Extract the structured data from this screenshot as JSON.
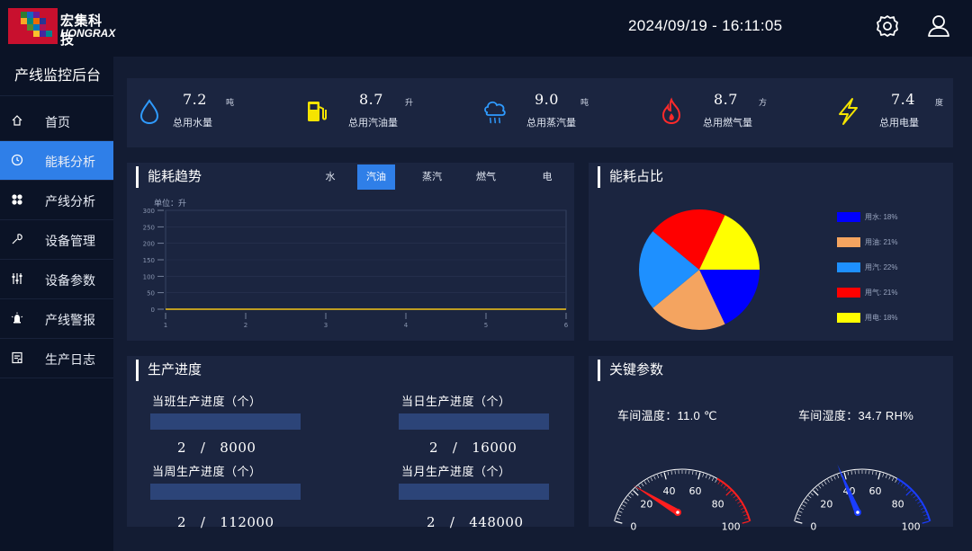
{
  "header": {
    "company_cn": "宏集科技",
    "company_en": "HONGRAX",
    "datetime": "2024/09/19 - 16:11:05",
    "settings_icon": "gear-icon",
    "user_icon": "user-icon"
  },
  "sidebar": {
    "title": "产线监控后台",
    "items": [
      {
        "label": "首页",
        "icon": "home-icon",
        "active": false
      },
      {
        "label": "能耗分析",
        "icon": "clock-icon",
        "active": true
      },
      {
        "label": "产线分析",
        "icon": "grid-icon",
        "active": false
      },
      {
        "label": "设备管理",
        "icon": "wrench-icon",
        "active": false
      },
      {
        "label": "设备参数",
        "icon": "sliders-icon",
        "active": false
      },
      {
        "label": "产线警报",
        "icon": "alarm-icon",
        "active": false
      },
      {
        "label": "生产日志",
        "icon": "log-icon",
        "active": false
      }
    ]
  },
  "kpis": [
    {
      "value": "7.2",
      "unit": "吨",
      "name": "总用水量",
      "icon": "water-drop-icon",
      "color": "#2f9bff"
    },
    {
      "value": "8.7",
      "unit": "升",
      "name": "总用汽油量",
      "icon": "fuel-pump-icon",
      "color": "#f5e400"
    },
    {
      "value": "9.0",
      "unit": "吨",
      "name": "总用蒸汽量",
      "icon": "steam-cloud-icon",
      "color": "#2f9bff"
    },
    {
      "value": "8.7",
      "unit": "方",
      "name": "总用燃气量",
      "icon": "flame-icon",
      "color": "#ff2a2a"
    },
    {
      "value": "7.4",
      "unit": "度",
      "name": "总用电量",
      "icon": "lightning-icon",
      "color": "#f5e400"
    }
  ],
  "trend": {
    "title": "能耗趋势",
    "tabs": [
      "水",
      "汽油",
      "蒸汽",
      "燃气",
      "电"
    ],
    "active_tab": 1
  },
  "ratio": {
    "title": "能耗占比"
  },
  "progress": {
    "title": "生产进度",
    "items": [
      {
        "label": "当班生产进度（个）",
        "current": "2",
        "sep": "/",
        "total": "8000",
        "fraction": 0.00025
      },
      {
        "label": "当日生产进度（个）",
        "current": "2",
        "sep": "/",
        "total": "16000",
        "fraction": 0.000125
      },
      {
        "label": "当周生产进度（个）",
        "current": "2",
        "sep": "/",
        "total": "112000",
        "fraction": 1.79e-05
      },
      {
        "label": "当月生产进度（个）",
        "current": "2",
        "sep": "/",
        "total": "448000",
        "fraction": 4.5e-06
      }
    ]
  },
  "params": {
    "title": "关键参数",
    "temp_label": "车间温度：11.0 ℃",
    "humid_label": "车间湿度：34.7 RH%",
    "temp_value": 11.0,
    "humid_value": 34.7,
    "gauge_ticks": [
      "0",
      "20",
      "40",
      "60",
      "80",
      "100"
    ],
    "temp_color": "#ff1e1e",
    "humid_color": "#1a3dff"
  },
  "chart_data": [
    {
      "type": "line",
      "title": "",
      "unit_label": "单位：升",
      "x": [
        1,
        2,
        3,
        4,
        5,
        6
      ],
      "series": [
        {
          "values": [
            0,
            0,
            0,
            0,
            0,
            0
          ],
          "color": "#f5c518"
        }
      ],
      "y_ticks": [
        0,
        50,
        100,
        150,
        200,
        250,
        300
      ],
      "ylim": [
        0,
        300
      ],
      "xlim": [
        1,
        6
      ]
    },
    {
      "type": "pie",
      "labels": [
        "用水",
        "用油",
        "用汽",
        "用气",
        "用电"
      ],
      "legend": [
        "用水: 18%",
        "用油: 21%",
        "用汽: 22%",
        "用气: 21%",
        "用电: 18%"
      ],
      "values": [
        18,
        21,
        22,
        21,
        18
      ],
      "colors": [
        "#0000ff",
        "#f4a460",
        "#1e90ff",
        "#ff0000",
        "#ffff00"
      ]
    }
  ]
}
